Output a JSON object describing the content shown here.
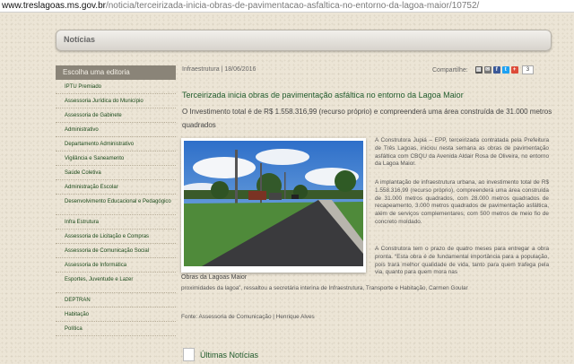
{
  "browser": {
    "url_host": "www.treslagoas.ms.gov.br",
    "url_path": "/noticia/terceirizada-inicia-obras-de-pavimentacao-asfaltica-no-entorno-da-lagoa-maior/10752/"
  },
  "header": {
    "title": "Notícias"
  },
  "sidebar": {
    "heading": "Escolha uma editoria",
    "items": [
      "IPTU Premiado",
      "Assessoria Jurídica do Município",
      "Assessoria de Gabinete",
      "Administrativo",
      "Departamento Administrativo",
      "Vigilância e Saneamento",
      "Saúde Coletiva",
      "Administração Escolar",
      "Desenvolvimento Educacional e Pedagógico",
      "Infra Estrutura",
      "Assessoria de Licitação e Compras",
      "Assessoria de Comunicação Social",
      "Assessoria de Informática",
      "Esportes, Juventude e Lazer",
      "DEPTRAN",
      "Habitação",
      "Política"
    ]
  },
  "article": {
    "meta": "Infraestrutura | 18/06/2016",
    "share_label": "Compartilhe:",
    "share_count": "3",
    "share_icons": [
      "print-icon",
      "email-icon",
      "facebook-icon",
      "twitter-icon",
      "googleplus-icon"
    ],
    "title": "Terceirizada inicia obras de pavimentação asfáltica no entorno da Lagoa Maior",
    "subtitle": "O Investimento total é de R$ 1.558.316,99 (recurso próprio) e compreenderá uma área construída de 31.000 metros quadrados",
    "photo_caption": "Obras da Lagoas Maior",
    "paragraphs": [
      "A Construtora Jupiá – EPP, terceirizada contratada pela Prefeitura de Três Lagoas, iniciou nesta semana as obras de pavimentação asfáltica com CBQU da Avenida Aldair Rosa de Oliveira, no entorno da Lagoa Maior.",
      "A implantação de infraestrutura urbana, ao investimento total de R$ 1.558.316,99 (recurso próprio), compreenderá uma área construída de 31.000 metros quadrados, com 28.000 metros quadrados de recapeamento, 3.000 metros quadrados de pavimentação asfáltica, além de serviços complementares, com 500 metros de meio fio de concreto moldado.",
      "A Construtora tem o prazo de quatro meses para entregar a obra pronta. “Esta obra é de fundamental importância para a população, pois trará melhor qualidade de vida, tanto para quem trafega pela via, quanto para quem mora nas"
    ],
    "continuation": "proximidades da lagoa”, ressaltou a secretária interina de Infraestrutura, Transporte e Habitação, Carmen Goular",
    "source": "Fonte: Assessoria de Comunicação | Henrique Alves"
  },
  "latest": {
    "title": "Últimas Notícias"
  },
  "colors": {
    "accent_green": "#1f5a2a",
    "sidebar_head_bg": "#8a8478",
    "facebook": "#3b5998",
    "twitter": "#1da1f2",
    "googleplus": "#dd4b39"
  }
}
